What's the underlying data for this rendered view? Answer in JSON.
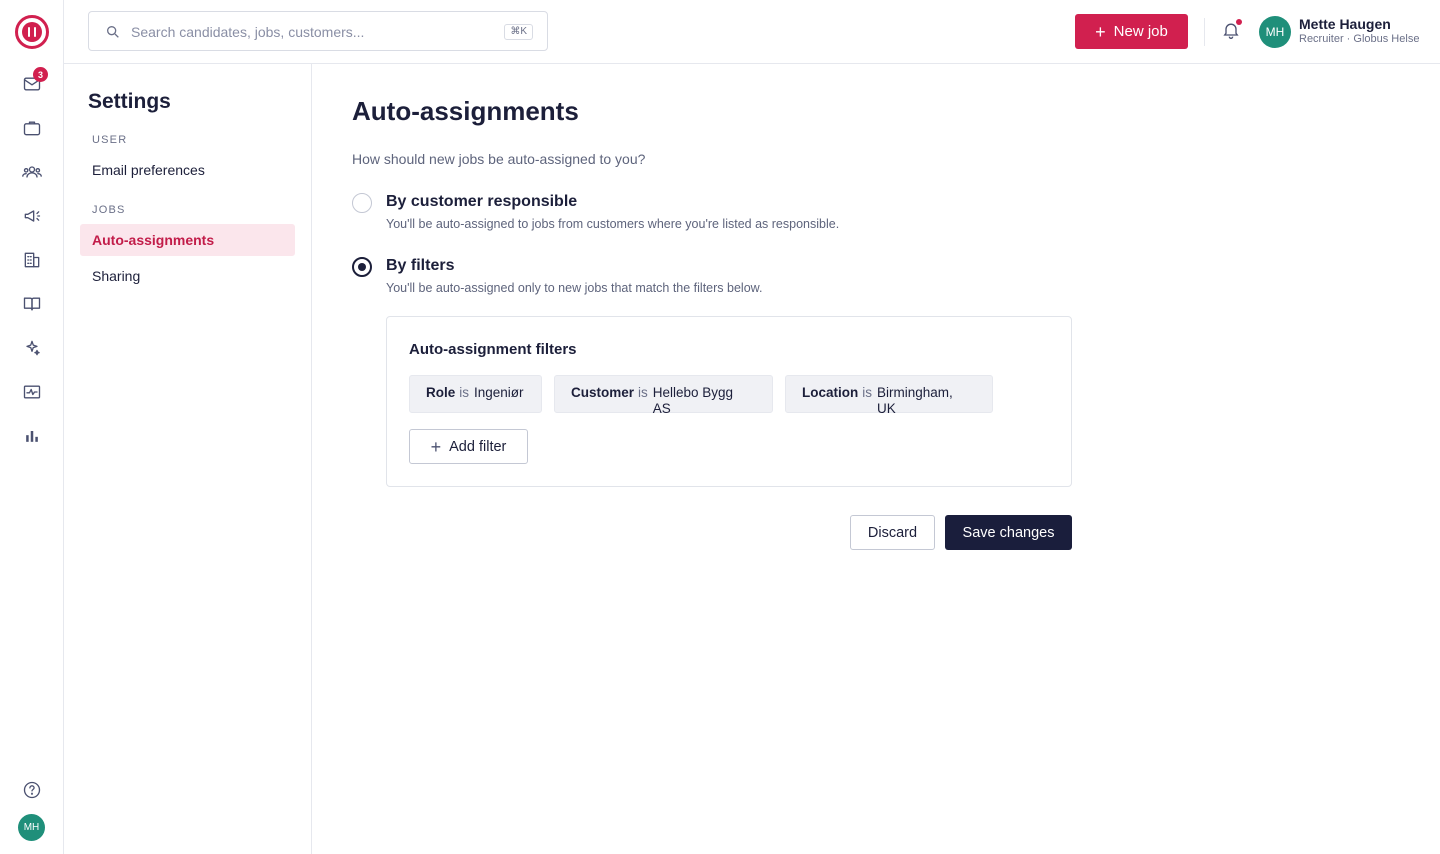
{
  "app": {
    "logo_icon": "brand-logo",
    "accent_color": "#d1204f",
    "rail": {
      "inbox_badge": "3",
      "user_initials": "MH",
      "icons": [
        "inbox-icon",
        "briefcase-icon",
        "people-icon",
        "megaphone-icon",
        "building-icon",
        "book-icon",
        "sparkles-icon",
        "activity-icon",
        "bar-chart-icon",
        "help-icon"
      ]
    }
  },
  "topbar": {
    "search_placeholder": "Search candidates, jobs, customers...",
    "search_shortcut": "⌘K",
    "new_job_label": "New job",
    "user": {
      "initials": "MH",
      "name": "Mette Haugen",
      "role": "Recruiter · Globus Helse"
    }
  },
  "settings_nav": {
    "title": "Settings",
    "sections": [
      {
        "label": "USER",
        "items": [
          {
            "label": "Email preferences"
          }
        ]
      },
      {
        "label": "JOBS",
        "items": [
          {
            "label": "Auto-assignments",
            "active": true
          },
          {
            "label": "Sharing"
          }
        ]
      }
    ]
  },
  "main": {
    "title": "Auto-assignments",
    "question": "How should new jobs be auto-assigned to you?",
    "options": [
      {
        "label": "By customer responsible",
        "description": "You'll be auto-assigned to jobs from customers where you're listed as responsible.",
        "selected": false
      },
      {
        "label": "By filters",
        "description": "You'll be auto-assigned only to new jobs that match the filters below.",
        "selected": true
      }
    ],
    "filters": {
      "title": "Auto-assignment filters",
      "chips": [
        {
          "key": "Role",
          "op": "is",
          "value": "Ingeniør"
        },
        {
          "key": "Customer",
          "op": "is",
          "value": "Hellebo Bygg AS"
        },
        {
          "key": "Location",
          "op": "is",
          "value": "Birmingham, UK"
        }
      ],
      "add_label": "Add filter"
    },
    "actions": {
      "discard_label": "Discard",
      "save_label": "Save changes"
    }
  }
}
